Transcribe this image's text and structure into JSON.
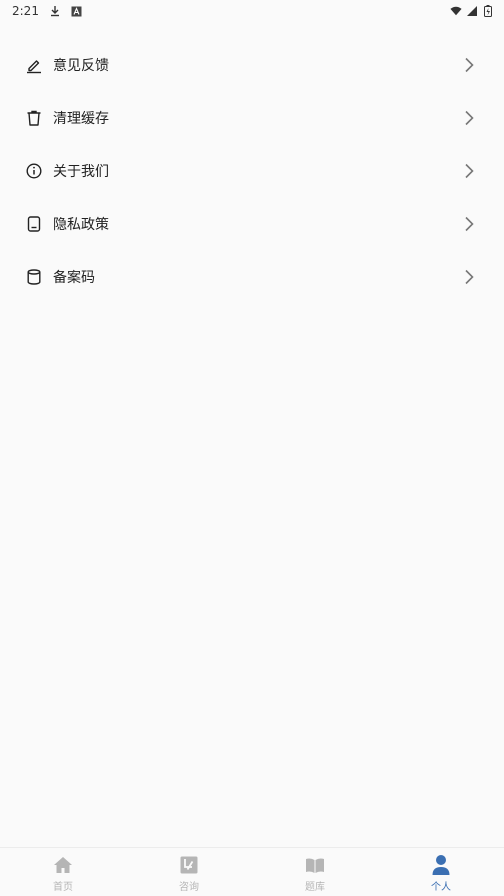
{
  "status_bar": {
    "time": "2:21",
    "icons": [
      "download-icon",
      "a-icon",
      "wifi-icon",
      "signal-icon",
      "battery-icon"
    ]
  },
  "menu": {
    "items": [
      {
        "label": "意见反馈",
        "icon": "edit-icon"
      },
      {
        "label": "清理缓存",
        "icon": "trash-icon"
      },
      {
        "label": "关于我们",
        "icon": "info-icon"
      },
      {
        "label": "隐私政策",
        "icon": "document-icon"
      },
      {
        "label": "备案码",
        "icon": "database-icon"
      }
    ]
  },
  "bottom_nav": {
    "items": [
      {
        "label": "首页",
        "icon": "home-icon",
        "active": false
      },
      {
        "label": "咨询",
        "icon": "chat-icon",
        "active": false
      },
      {
        "label": "题库",
        "icon": "book-icon",
        "active": false
      },
      {
        "label": "个人",
        "icon": "user-icon",
        "active": true
      }
    ],
    "active_color": "#3b6fb2",
    "inactive_color": "#b5b5b5"
  }
}
